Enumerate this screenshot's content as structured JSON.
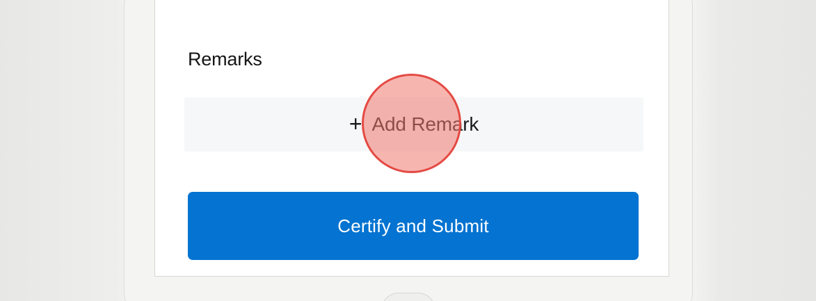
{
  "remarks": {
    "title": "Remarks",
    "add_icon": "plus-icon",
    "add_icon_glyph": "+",
    "add_label": "Add Remark"
  },
  "actions": {
    "submit_label": "Certify and Submit"
  },
  "colors": {
    "primary": "#0473d1",
    "tap_indicator": "#e44a43",
    "text": "#151515",
    "background": "#ffffff"
  }
}
